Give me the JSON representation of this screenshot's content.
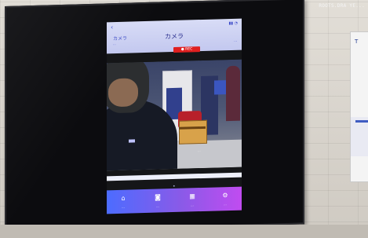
{
  "watermark": "ROOTS.DRA YE...",
  "app": {
    "title": "カメラ",
    "left_title": "カメラ",
    "left_sub": "...",
    "right_sub": "...",
    "record_badge": "● REC",
    "back_icon": "chevron-left-icon",
    "camera_text": "...",
    "pager": "•"
  },
  "bottom_nav": [
    {
      "label": "...",
      "icon": "home-icon"
    },
    {
      "label": "...",
      "icon": "camera-icon"
    },
    {
      "label": "...",
      "icon": "grid-icon"
    },
    {
      "label": "...",
      "icon": "settings-icon"
    }
  ],
  "poster": {
    "logo": "T"
  }
}
